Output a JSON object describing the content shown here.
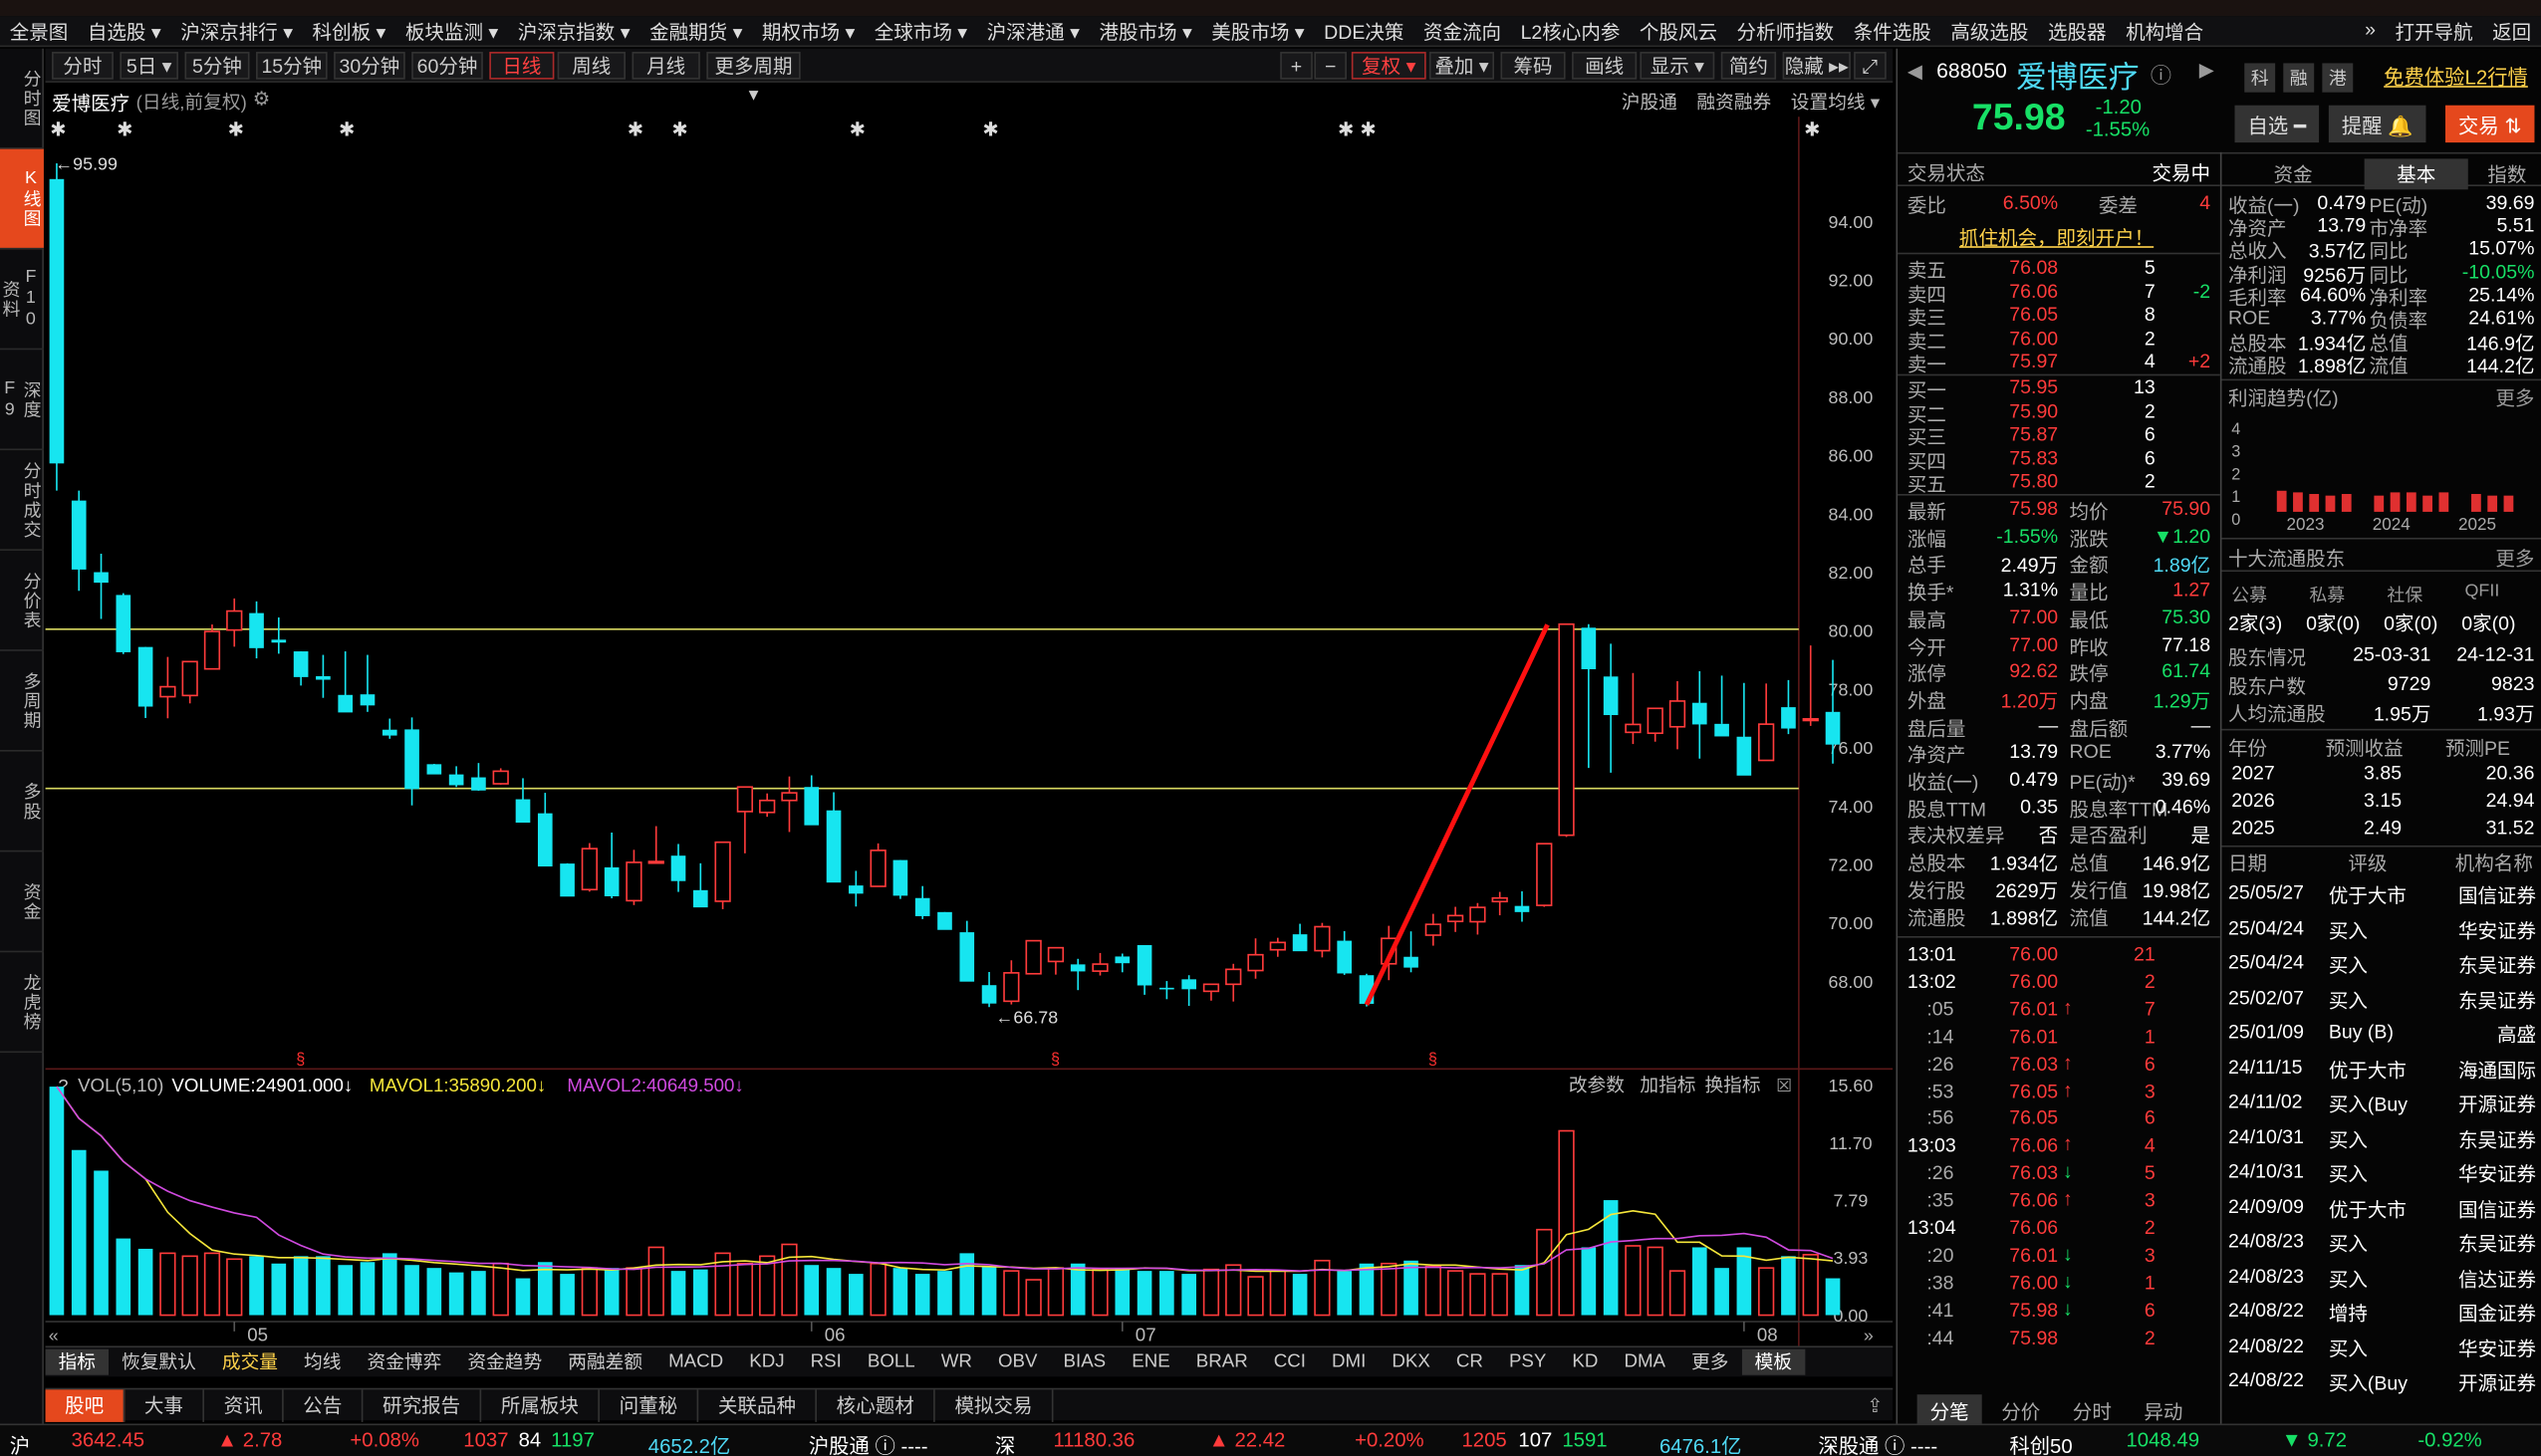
{
  "topmenu": {
    "items": [
      "全景图",
      "自选股",
      "沪深京排行",
      "科创板",
      "板块监测",
      "沪深京指数",
      "金融期货",
      "期权市场",
      "全球市场",
      "沪深港通",
      "港股市场",
      "美股市场",
      "DDE决策",
      "资金流向",
      "L2核心内参",
      "个股风云",
      "分析师指数",
      "条件选股",
      "高级选股",
      "选股器",
      "机构增合"
    ],
    "right": [
      "»",
      "打开导航",
      "返回"
    ]
  },
  "leftnav": [
    "分时图",
    "K线图",
    "F10资料",
    "深度F9",
    "分时成交",
    "分价表",
    "多周期",
    "多股",
    "资金",
    "龙虎榜"
  ],
  "toolbar": {
    "periods": [
      "分时",
      "5日",
      "5分钟",
      "15分钟",
      "30分钟",
      "60分钟",
      "日线",
      "周线",
      "月线",
      "更多周期"
    ],
    "right": [
      "+",
      "−",
      "复权",
      "叠加",
      "筹码",
      "画线",
      "显示",
      "简约",
      "隐藏"
    ]
  },
  "charthead": {
    "name": "爱博医疗",
    "mode": "(日线,前复权)",
    "right": [
      "沪股通",
      "融资融券",
      "设置均线"
    ]
  },
  "kline": {
    "high_label": "95.99",
    "low_label": "66.78",
    "y_ticks": [
      "94.00",
      "92.00",
      "90.00",
      "88.00",
      "86.00",
      "84.00",
      "82.00",
      "80.00",
      "78.00",
      "76.00",
      "74.00",
      "72.00",
      "70.00",
      "68.00"
    ],
    "x_ticks": [
      "05",
      "06",
      "07",
      "08"
    ],
    "candles": [
      [
        95.45,
        95.99,
        84.79,
        85.72
      ],
      [
        84.45,
        84.79,
        81.36,
        82.09
      ],
      [
        82.0,
        82.63,
        80.4,
        81.64
      ],
      [
        81.22,
        81.28,
        79.2,
        79.26
      ],
      [
        79.44,
        79.44,
        77.01,
        77.4
      ],
      [
        77.74,
        79.1,
        77.0,
        78.08
      ],
      [
        77.78,
        78.96,
        77.51,
        78.94
      ],
      [
        78.69,
        80.21,
        78.69,
        79.97
      ],
      [
        80.02,
        81.1,
        79.45,
        80.67
      ],
      [
        80.6,
        81.0,
        79.05,
        79.4
      ],
      [
        79.69,
        80.45,
        79.21,
        79.59
      ],
      [
        79.29,
        79.29,
        78.12,
        78.41
      ],
      [
        78.44,
        79.17,
        77.7,
        78.32
      ],
      [
        77.8,
        79.29,
        77.32,
        77.2
      ],
      [
        77.82,
        79.17,
        77.22,
        77.44
      ],
      [
        76.61,
        76.99,
        76.3,
        76.41
      ],
      [
        76.62,
        77.03,
        74.02,
        74.58
      ],
      [
        75.43,
        75.44,
        75.33,
        75.08
      ],
      [
        75.08,
        75.36,
        74.65,
        74.71
      ],
      [
        74.98,
        75.47,
        74.52,
        74.53
      ],
      [
        74.76,
        75.29,
        74.73,
        75.19
      ],
      [
        74.23,
        74.95,
        73.77,
        73.43
      ],
      [
        73.75,
        74.45,
        73.42,
        71.93
      ],
      [
        72.03,
        72.04,
        70.96,
        70.9
      ],
      [
        71.14,
        72.73,
        71.07,
        72.54
      ],
      [
        71.9,
        73.09,
        70.84,
        70.91
      ],
      [
        70.76,
        72.5,
        70.61,
        72.07
      ],
      [
        72.1,
        73.31,
        72.1,
        72.1
      ],
      [
        72.3,
        72.7,
        71.06,
        71.43
      ],
      [
        71.12,
        72.04,
        70.76,
        70.53
      ],
      [
        70.74,
        72.77,
        70.47,
        72.76
      ],
      [
        73.81,
        74.02,
        72.38,
        74.65
      ],
      [
        73.78,
        74.43,
        73.63,
        74.19
      ],
      [
        74.19,
        75.01,
        73.11,
        74.45
      ],
      [
        74.65,
        75.05,
        73.79,
        73.34
      ],
      [
        73.85,
        74.47,
        73.81,
        71.38
      ],
      [
        71.28,
        71.78,
        70.56,
        71.0
      ],
      [
        71.25,
        72.72,
        71.25,
        72.48
      ],
      [
        72.15,
        72.15,
        70.82,
        70.93
      ],
      [
        70.85,
        71.26,
        70.13,
        70.23
      ],
      [
        70.37,
        70.37,
        70.06,
        69.76
      ],
      [
        69.68,
        70.07,
        69.59,
        67.99
      ],
      [
        67.87,
        68.32,
        67.12,
        67.24
      ],
      [
        67.32,
        68.72,
        67.21,
        68.29
      ],
      [
        68.26,
        69.39,
        68.29,
        69.39
      ],
      [
        68.68,
        69.15,
        68.23,
        69.15
      ],
      [
        68.58,
        68.77,
        67.7,
        68.34
      ],
      [
        68.35,
        68.97,
        68.2,
        68.59
      ],
      [
        68.85,
        68.95,
        68.31,
        68.62
      ],
      [
        69.24,
        69.24,
        67.54,
        67.86
      ],
      [
        67.78,
        68.01,
        67.39,
        67.76
      ],
      [
        68.07,
        68.21,
        67.16,
        67.73
      ],
      [
        67.66,
        67.92,
        67.34,
        67.9
      ],
      [
        67.9,
        68.6,
        67.31,
        68.41
      ],
      [
        68.37,
        69.47,
        68.09,
        68.91
      ],
      [
        69.08,
        69.49,
        68.84,
        69.33
      ],
      [
        69.61,
        69.97,
        69.09,
        69.03
      ],
      [
        69.05,
        70.0,
        68.82,
        69.87
      ],
      [
        69.39,
        69.72,
        68.22,
        68.27
      ],
      [
        68.21,
        68.26,
        67.14,
        67.23
      ],
      [
        68.6,
        69.9,
        68.04,
        69.47
      ],
      [
        68.84,
        69.71,
        68.31,
        68.47
      ],
      [
        69.58,
        70.31,
        69.22,
        69.95
      ],
      [
        70.05,
        70.55,
        69.69,
        70.25
      ],
      [
        70.04,
        70.68,
        69.6,
        70.53
      ],
      [
        70.73,
        71.06,
        70.26,
        70.85
      ],
      [
        70.58,
        71.08,
        70.04,
        70.37
      ],
      [
        70.6,
        72.19,
        70.55,
        72.71
      ],
      [
        73.0,
        76.58,
        72.94,
        80.22
      ],
      [
        80.1,
        80.22,
        75.3,
        78.68
      ],
      [
        78.43,
        79.55,
        75.14,
        77.11
      ],
      [
        76.52,
        78.55,
        76.12,
        76.79
      ],
      [
        76.49,
        76.58,
        76.2,
        77.34
      ],
      [
        76.71,
        78.27,
        75.94,
        77.59
      ],
      [
        77.53,
        78.61,
        75.62,
        76.79
      ],
      [
        76.81,
        78.46,
        76.81,
        76.38
      ],
      [
        76.37,
        78.21,
        75.81,
        75.04
      ],
      [
        75.56,
        78.19,
        75.55,
        76.8
      ],
      [
        77.38,
        78.31,
        76.46,
        76.65
      ],
      [
        76.97,
        79.49,
        76.74,
        76.98
      ],
      [
        77.22,
        79.0,
        75.45,
        76.1
      ]
    ],
    "trend_line": [
      [
        67.2,
        80.2
      ]
    ],
    "flags": [
      "✱",
      "✱",
      "✱",
      "✱",
      "✱",
      "✱",
      "✱",
      "✱",
      "✱",
      "✱",
      "✱"
    ],
    "s_marks": [
      "§",
      "§",
      "§"
    ]
  },
  "volume": {
    "label": "VOL(5,10)",
    "value": "VOLUME:24901.000↓",
    "ma1": "MAVOL1:35890.200↓",
    "ma2": "MAVOL2:40649.500↓",
    "y_ticks": [
      "15.60",
      "11.70",
      "7.79",
      "3.93",
      "0.00"
    ],
    "right": [
      "改参数",
      "加指标",
      "换指标"
    ],
    "bars": [
      15.5,
      11.2,
      9.8,
      5.2,
      4.5,
      4.2,
      4.0,
      4.2,
      3.8,
      4.0,
      3.5,
      4.0,
      4.0,
      3.4,
      3.6,
      4.2,
      3.4,
      3.2,
      2.9,
      3.0,
      3.5,
      2.5,
      3.6,
      2.8,
      3.2,
      3.2,
      3.2,
      4.6,
      3.0,
      3.1,
      4.2,
      3.5,
      4.0,
      4.8,
      3.4,
      3.2,
      2.8,
      3.5,
      3.2,
      2.8,
      3.0,
      4.2,
      3.3,
      3.0,
      2.4,
      3.2,
      3.5,
      3.1,
      3.2,
      3.0,
      3.0,
      2.8,
      3.1,
      3.4,
      2.6,
      3.0,
      2.8,
      3.7,
      3.0,
      3.5,
      3.5,
      3.7,
      3.3,
      3.0,
      2.8,
      2.8,
      3.4,
      5.8,
      12.5,
      4.6,
      7.8,
      4.7,
      4.6,
      3.0,
      4.6,
      3.2,
      4.6,
      3.2,
      4.0,
      4.1,
      2.5
    ]
  },
  "indicators": [
    "指标",
    "恢复默认",
    "成交量",
    "均线",
    "资金博弈",
    "资金趋势",
    "两融差额",
    "MACD",
    "KDJ",
    "RSI",
    "BOLL",
    "WR",
    "OBV",
    "BIAS",
    "ENE",
    "BRAR",
    "CCI",
    "DMI",
    "DKX",
    "CR",
    "PSY",
    "KD",
    "DMA",
    "更多",
    "模板"
  ],
  "bottomtabs": [
    "股吧",
    "大事",
    "资讯",
    "公告",
    "研究报告",
    "所属板块",
    "问董秘",
    "关联品种",
    "核心题材",
    "模拟交易"
  ],
  "statusbar": {
    "sh_index": "3642.45",
    "sh_chg": "▲ 2.78",
    "sh_pct": "+0.08%",
    "sh_up": "1037",
    "sh_flat": "84",
    "sh_down": "1197",
    "sh_amt": "4652.2亿",
    "sh_link": "沪股通 ⓘ ----",
    "sz_label": "深",
    "sz_index": "11180.36",
    "sz_chg": "▲ 22.42",
    "sz_pct": "+0.20%",
    "sz_up": "1205",
    "sz_flat": "107",
    "sz_down": "1591",
    "sz_amt": "6476.1亿",
    "sz_link": "深股通 ⓘ ----",
    "kc_label": "科创50",
    "kc_index": "1048.49",
    "kc_chg": "▼ 9.72",
    "kc_pct": "-0.92%"
  },
  "quote": {
    "code": "688050",
    "name": "爱博医疗",
    "price": "75.98",
    "chg": "-1.20",
    "pct": "-1.55%",
    "tags": [
      "科",
      "融",
      "港"
    ],
    "promo": "免费体验L2行情",
    "btn_watch": "自选",
    "btn_alert": "提醒",
    "btn_trade": "交易"
  },
  "trade_status": {
    "label": "交易状态",
    "value": "交易中",
    "wb_label": "委比",
    "wb": "6.50%",
    "wc_label": "委差",
    "wc": "4",
    "promo": "抓住机会，即刻开户！"
  },
  "asks": [
    [
      "卖五",
      "76.08",
      "5",
      ""
    ],
    [
      "卖四",
      "76.06",
      "7",
      "-2"
    ],
    [
      "卖三",
      "76.05",
      "8",
      ""
    ],
    [
      "卖二",
      "76.00",
      "2",
      ""
    ],
    [
      "卖一",
      "75.97",
      "4",
      "+2"
    ]
  ],
  "bids": [
    [
      "买一",
      "75.95",
      "13"
    ],
    [
      "买二",
      "75.90",
      "2"
    ],
    [
      "买三",
      "75.87",
      "6"
    ],
    [
      "买四",
      "75.83",
      "6"
    ],
    [
      "买五",
      "75.80",
      "2"
    ]
  ],
  "stats": [
    [
      "最新",
      "75.98",
      "均价",
      "75.90"
    ],
    [
      "涨幅",
      "-1.55%",
      "涨跌",
      "▼1.20"
    ],
    [
      "总手",
      "2.49万",
      "金额",
      "1.89亿"
    ],
    [
      "换手*",
      "1.31%",
      "量比",
      "1.27"
    ],
    [
      "最高",
      "77.00",
      "最低",
      "75.30"
    ],
    [
      "今开",
      "77.00",
      "昨收",
      "77.18"
    ],
    [
      "涨停",
      "92.62",
      "跌停",
      "61.74"
    ],
    [
      "外盘",
      "1.20万",
      "内盘",
      "1.29万"
    ],
    [
      "盘后量",
      "—",
      "盘后额",
      "—"
    ],
    [
      "净资产",
      "13.79",
      "ROE",
      "3.77%"
    ],
    [
      "收益(一)",
      "0.479",
      "PE(动)*",
      "39.69"
    ],
    [
      "股息TTM",
      "0.35",
      "股息率TTM",
      "0.46%"
    ],
    [
      "表决权差异",
      "否",
      "是否盈利",
      "是"
    ],
    [
      "总股本",
      "1.934亿",
      "总值",
      "146.9亿"
    ],
    [
      "发行股",
      "2629万",
      "发行值",
      "19.98亿"
    ],
    [
      "流通股",
      "1.898亿",
      "流值",
      "144.2亿"
    ]
  ],
  "ticks": [
    [
      "13:01",
      "76.00",
      "21",
      ""
    ],
    [
      "13:02",
      "76.00",
      "2",
      ""
    ],
    [
      ":05",
      "76.01",
      "7",
      "up"
    ],
    [
      ":14",
      "76.01",
      "1",
      ""
    ],
    [
      ":26",
      "76.03",
      "6",
      "up"
    ],
    [
      ":53",
      "76.05",
      "3",
      "up"
    ],
    [
      ":56",
      "76.05",
      "6",
      ""
    ],
    [
      "13:03",
      "76.06",
      "4",
      "up"
    ],
    [
      ":26",
      "76.03",
      "5",
      "dn"
    ],
    [
      ":35",
      "76.06",
      "3",
      "up"
    ],
    [
      "13:04",
      "76.06",
      "2",
      ""
    ],
    [
      ":20",
      "76.01",
      "3",
      "dn"
    ],
    [
      ":38",
      "76.00",
      "1",
      "dn"
    ],
    [
      ":41",
      "75.98",
      "6",
      "dn"
    ],
    [
      ":44",
      "75.98",
      "2",
      ""
    ]
  ],
  "ticktabs": [
    "分笔",
    "分价",
    "分时",
    "异动"
  ],
  "fund_tabs": [
    "资金",
    "基本",
    "指数"
  ],
  "fundamentals": [
    [
      "收益(一)",
      "0.479",
      "PE(动)",
      "39.69"
    ],
    [
      "净资产",
      "13.79",
      "市净率",
      "5.51"
    ],
    [
      "总收入",
      "3.57亿",
      "同比",
      "15.07%"
    ],
    [
      "净利润",
      "9256万",
      "同比",
      "-10.05%"
    ],
    [
      "毛利率",
      "64.60%",
      "净利率",
      "25.14%"
    ],
    [
      "ROE",
      "3.77%",
      "负债率",
      "24.61%"
    ],
    [
      "总股本",
      "1.934亿",
      "总值",
      "146.9亿"
    ],
    [
      "流通股",
      "1.898亿",
      "流值",
      "144.2亿"
    ]
  ],
  "profit": {
    "title": "利润趋势(亿)",
    "more": "更多",
    "y": [
      "4",
      "3",
      "2",
      "1",
      "0"
    ],
    "years": [
      "2023",
      "2024",
      "2025"
    ],
    "bars": [
      1.1,
      1.0,
      0.9,
      0.8,
      0.9,
      0.8,
      1.0,
      1.0,
      0.8,
      1.0,
      0.9,
      0.8,
      0.8
    ]
  },
  "holders": {
    "title": "十大流通股东",
    "more": "更多",
    "heads": [
      "公募",
      "私募",
      "社保",
      "QFII"
    ],
    "vals": [
      "2家(3)",
      "0家(0)",
      "0家(0)",
      "0家(0)"
    ],
    "rows": [
      [
        "股东情况",
        "25-03-31",
        "24-12-31"
      ],
      [
        "股东户数",
        "9729",
        "9823"
      ],
      [
        "人均流通股",
        "1.95万",
        "1.93万"
      ]
    ]
  },
  "forecast": {
    "heads": [
      "年份",
      "预测收益",
      "预测PE"
    ],
    "rows": [
      [
        "2027",
        "3.85",
        "20.36"
      ],
      [
        "2026",
        "3.15",
        "24.94"
      ],
      [
        "2025",
        "2.49",
        "31.52"
      ]
    ]
  },
  "ratings": {
    "heads": [
      "日期",
      "评级",
      "机构名称"
    ],
    "rows": [
      [
        "25/05/27",
        "优于大市",
        "国信证券"
      ],
      [
        "25/04/24",
        "买入",
        "华安证券"
      ],
      [
        "25/04/24",
        "买入",
        "东吴证券"
      ],
      [
        "25/02/07",
        "买入",
        "东吴证券"
      ],
      [
        "25/01/09",
        "Buy (B)",
        "高盛"
      ],
      [
        "24/11/15",
        "优于大市",
        "海通国际"
      ],
      [
        "24/11/02",
        "买入(Buy",
        "开源证券"
      ],
      [
        "24/10/31",
        "买入",
        "东吴证券"
      ],
      [
        "24/10/31",
        "买入",
        "华安证券"
      ],
      [
        "24/09/09",
        "优于大市",
        "国信证券"
      ],
      [
        "24/08/23",
        "买入",
        "东吴证券"
      ],
      [
        "24/08/23",
        "买入",
        "信达证券"
      ],
      [
        "24/08/22",
        "增持",
        "国金证券"
      ],
      [
        "24/08/22",
        "买入",
        "华安证券"
      ],
      [
        "24/08/22",
        "买入(Buy",
        "开源证券"
      ]
    ]
  },
  "colors": {
    "up": "#ff3b3b",
    "down": "#17e5f0",
    "accent": "#e5481d",
    "line": "#d8d860"
  }
}
